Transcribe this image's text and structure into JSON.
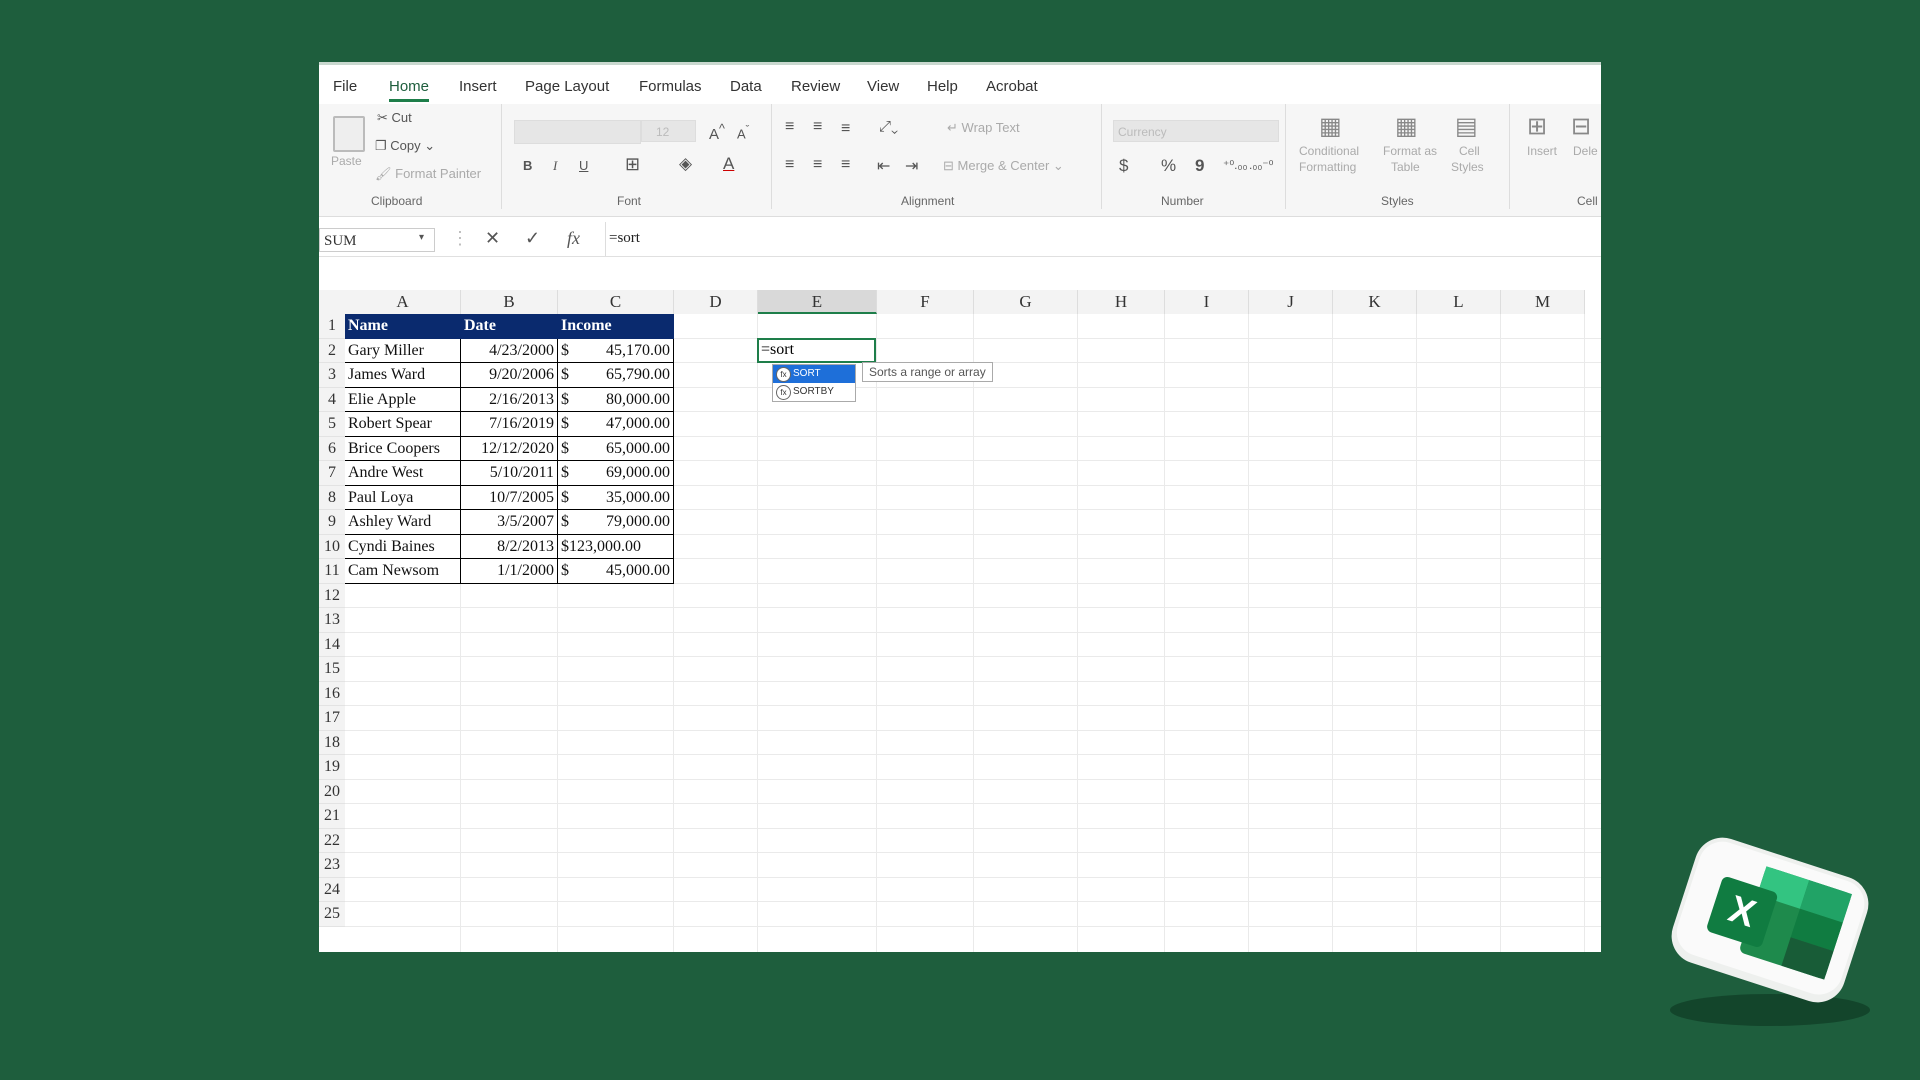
{
  "menu": {
    "items": [
      "File",
      "Home",
      "Insert",
      "Page Layout",
      "Formulas",
      "Data",
      "Review",
      "View",
      "Help",
      "Acrobat"
    ],
    "active": "Home"
  },
  "ribbon": {
    "clipboard": {
      "paste": "Paste",
      "cut": "Cut",
      "copy": "Copy",
      "format_painter": "Format Painter",
      "label": "Clipboard"
    },
    "font": {
      "label": "Font",
      "font_size": "12",
      "bold": "B",
      "italic": "I",
      "underline": "U"
    },
    "alignment": {
      "label": "Alignment",
      "wrap_text": "Wrap Text",
      "merge_center": "Merge & Center"
    },
    "number": {
      "label": "Number",
      "format": "Currency",
      "currency": "$",
      "percent": "%",
      "comma": "9"
    },
    "styles": {
      "label": "Styles",
      "conditional_line1": "Conditional",
      "conditional_line2": "Formatting",
      "format_table_line1": "Format as",
      "format_table_line2": "Table",
      "cell_styles_line1": "Cell",
      "cell_styles_line2": "Styles"
    },
    "cells": {
      "label": "Cell",
      "insert": "Insert",
      "delete": "Dele"
    }
  },
  "formula_bar": {
    "name_box": "SUM",
    "cancel": "✕",
    "enter": "✓",
    "fx": "fx",
    "formula": "=sort"
  },
  "columns": [
    "A",
    "B",
    "C",
    "D",
    "E",
    "F",
    "G",
    "H",
    "I",
    "J",
    "K",
    "L",
    "M"
  ],
  "rows": [
    "1",
    "2",
    "3",
    "4",
    "5",
    "6",
    "7",
    "8",
    "9",
    "10",
    "11",
    "12",
    "13",
    "14",
    "15",
    "16",
    "17",
    "18",
    "19",
    "20",
    "21",
    "22",
    "23",
    "24",
    "25"
  ],
  "table": {
    "headers": [
      "Name",
      "Date",
      "Income"
    ],
    "rows": [
      [
        "Gary Miller",
        "4/23/2000",
        "$",
        "45,170.00"
      ],
      [
        "James Ward",
        "9/20/2006",
        "$",
        "65,790.00"
      ],
      [
        "Elie Apple",
        "2/16/2013",
        "$",
        "80,000.00"
      ],
      [
        "Robert Spear",
        "7/16/2019",
        "$",
        "47,000.00"
      ],
      [
        "Brice Coopers",
        "12/12/2020",
        "$",
        "65,000.00"
      ],
      [
        "Andre West",
        "5/10/2011",
        "$",
        "69,000.00"
      ],
      [
        "Paul Loya",
        "10/7/2005",
        "$",
        "35,000.00"
      ],
      [
        "Ashley Ward",
        "3/5/2007",
        "$",
        "79,000.00"
      ],
      [
        "Cyndi Baines",
        "8/2/2013",
        "$123,000.00",
        ""
      ],
      [
        "Cam Newsom",
        "1/1/2000",
        "$",
        "45,000.00"
      ]
    ]
  },
  "active_cell": {
    "ref": "E2",
    "value": "=sort"
  },
  "autocomplete": {
    "items": [
      "SORT",
      "SORTBY"
    ],
    "selected": "SORT",
    "tooltip": "Sorts a range or array",
    "fn_icon": "fx"
  },
  "colors": {
    "background": "#1e5e3d",
    "table_header": "#0a2a6e",
    "accent": "#1e7e4a"
  }
}
